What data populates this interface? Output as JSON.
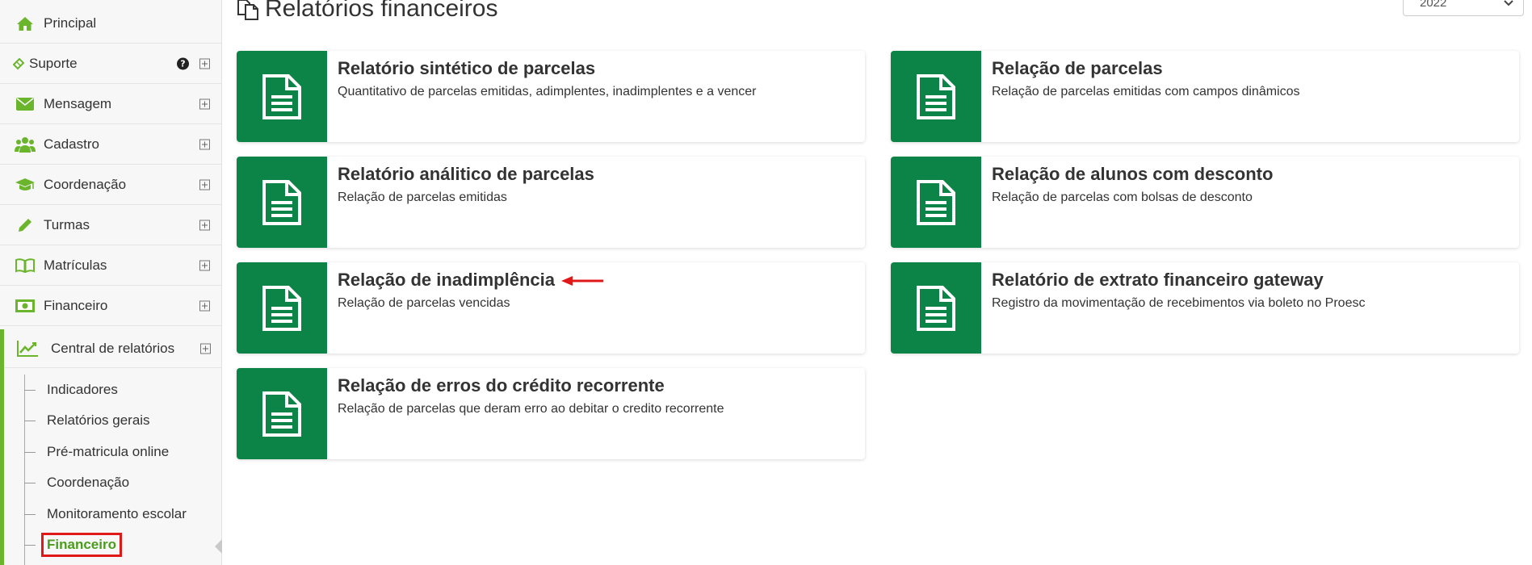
{
  "sidebar": {
    "items": [
      {
        "label": "Principal",
        "icon": "home-icon"
      },
      {
        "label": "Suporte",
        "icon": "ticket-icon"
      },
      {
        "label": "Mensagem",
        "icon": "envelope-icon"
      },
      {
        "label": "Cadastro",
        "icon": "users-icon"
      },
      {
        "label": "Coordenação",
        "icon": "graduation-cap-icon"
      },
      {
        "label": "Turmas",
        "icon": "pencil-icon"
      },
      {
        "label": "Matrículas",
        "icon": "book-icon"
      },
      {
        "label": "Financeiro",
        "icon": "money-icon"
      }
    ],
    "help_glyph": "?",
    "submenu": {
      "title": "Central de relatórios",
      "icon": "line-chart-icon",
      "items": [
        {
          "label": "Indicadores"
        },
        {
          "label": "Relatórios gerais"
        },
        {
          "label": "Pré-matricula online"
        },
        {
          "label": "Coordenação"
        },
        {
          "label": "Monitoramento escolar"
        },
        {
          "label": "Financeiro",
          "active": true
        }
      ]
    }
  },
  "main": {
    "title": "Relatórios financeiros",
    "year": "2022",
    "cards": [
      {
        "title": "Relatório sintético de parcelas",
        "desc": "Quantitativo de parcelas emitidas, adimplentes, inadimplentes e a vencer"
      },
      {
        "title": "Relação de parcelas",
        "desc": "Relação de parcelas emitidas com campos dinâmicos"
      },
      {
        "title": "Relatório análitico de parcelas",
        "desc": "Relação de parcelas emitidas"
      },
      {
        "title": "Relação de alunos com desconto",
        "desc": "Relação de parcelas com bolsas de desconto"
      },
      {
        "title": "Relação de inadimplência",
        "desc": "Relação de parcelas vencidas"
      },
      {
        "title": "Relatório de extrato financeiro gateway",
        "desc": "Registro da movimentação de recebimentos via boleto no Proesc"
      },
      {
        "title": "Relação de erros do crédito recorrente",
        "desc": "Relação de parcelas que deram erro ao debitar o credito recorrente"
      }
    ]
  },
  "colors": {
    "accent_green": "#6bb52d",
    "card_green": "#0d8447",
    "highlight_red": "#e01818"
  }
}
